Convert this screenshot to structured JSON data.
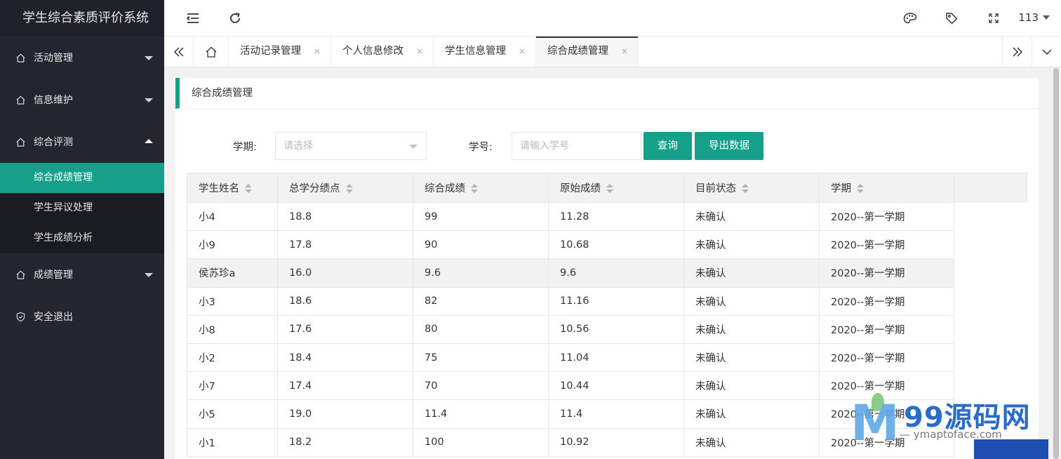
{
  "sidebar": {
    "brand": "学生综合素质评价系统",
    "menu": [
      {
        "label": "活动管理",
        "icon": "home-icon"
      },
      {
        "label": "信息维护",
        "icon": "home-icon"
      },
      {
        "label": "综合评测",
        "icon": "home-icon"
      }
    ],
    "submenu": [
      {
        "label": "综合成绩管理"
      },
      {
        "label": "学生异议处理"
      },
      {
        "label": "学生成绩分析"
      }
    ],
    "menu_after": [
      {
        "label": "成绩管理",
        "icon": "home-icon"
      },
      {
        "label": "安全退出",
        "icon": "shield-icon"
      }
    ]
  },
  "header": {
    "user": "113",
    "icons": [
      "menu-fold-icon",
      "refresh-icon",
      "palette-icon",
      "tag-icon",
      "fullscreen-icon"
    ]
  },
  "tabs": [
    {
      "label": "活动记录管理"
    },
    {
      "label": "个人信息修改"
    },
    {
      "label": "学生信息管理"
    },
    {
      "label": "综合成绩管理"
    }
  ],
  "tab_close": "×",
  "card": {
    "title": "综合成绩管理"
  },
  "filters": {
    "term_label": "学期:",
    "term_placeholder": "请选择",
    "sid_label": "学号:",
    "sid_placeholder": "请输入学号",
    "query_button": "查询",
    "export_button": "导出数据"
  },
  "table": {
    "columns": [
      "学生姓名",
      "总学分绩点",
      "综合成绩",
      "原始成绩",
      "目前状态",
      "学期"
    ],
    "rows": [
      [
        "小4",
        "18.8",
        "99",
        "11.28",
        "未确认",
        "2020--第一学期"
      ],
      [
        "小9",
        "17.8",
        "90",
        "10.68",
        "未确认",
        "2020--第一学期"
      ],
      [
        "侯苏珍a",
        "16.0",
        "9.6",
        "9.6",
        "未确认",
        "2020--第一学期"
      ],
      [
        "小3",
        "18.6",
        "82",
        "11.16",
        "未确认",
        "2020--第一学期"
      ],
      [
        "小8",
        "17.6",
        "80",
        "10.56",
        "未确认",
        "2020--第一学期"
      ],
      [
        "小2",
        "18.4",
        "75",
        "11.04",
        "未确认",
        "2020--第一学期"
      ],
      [
        "小7",
        "17.4",
        "70",
        "10.44",
        "未确认",
        "2020--第一学期"
      ],
      [
        "小5",
        "19.0",
        "11.4",
        "11.4",
        "未确认",
        "2020--第一学期"
      ],
      [
        "小1",
        "18.2",
        "100",
        "10.92",
        "未确认",
        "2020--第一学期"
      ]
    ]
  },
  "watermark": {
    "logo_letter": "M",
    "site": "99源码网",
    "sub": "— ymaptoface.com"
  },
  "colors": {
    "accent": "#16a08a",
    "sidebar": "#23262e"
  }
}
